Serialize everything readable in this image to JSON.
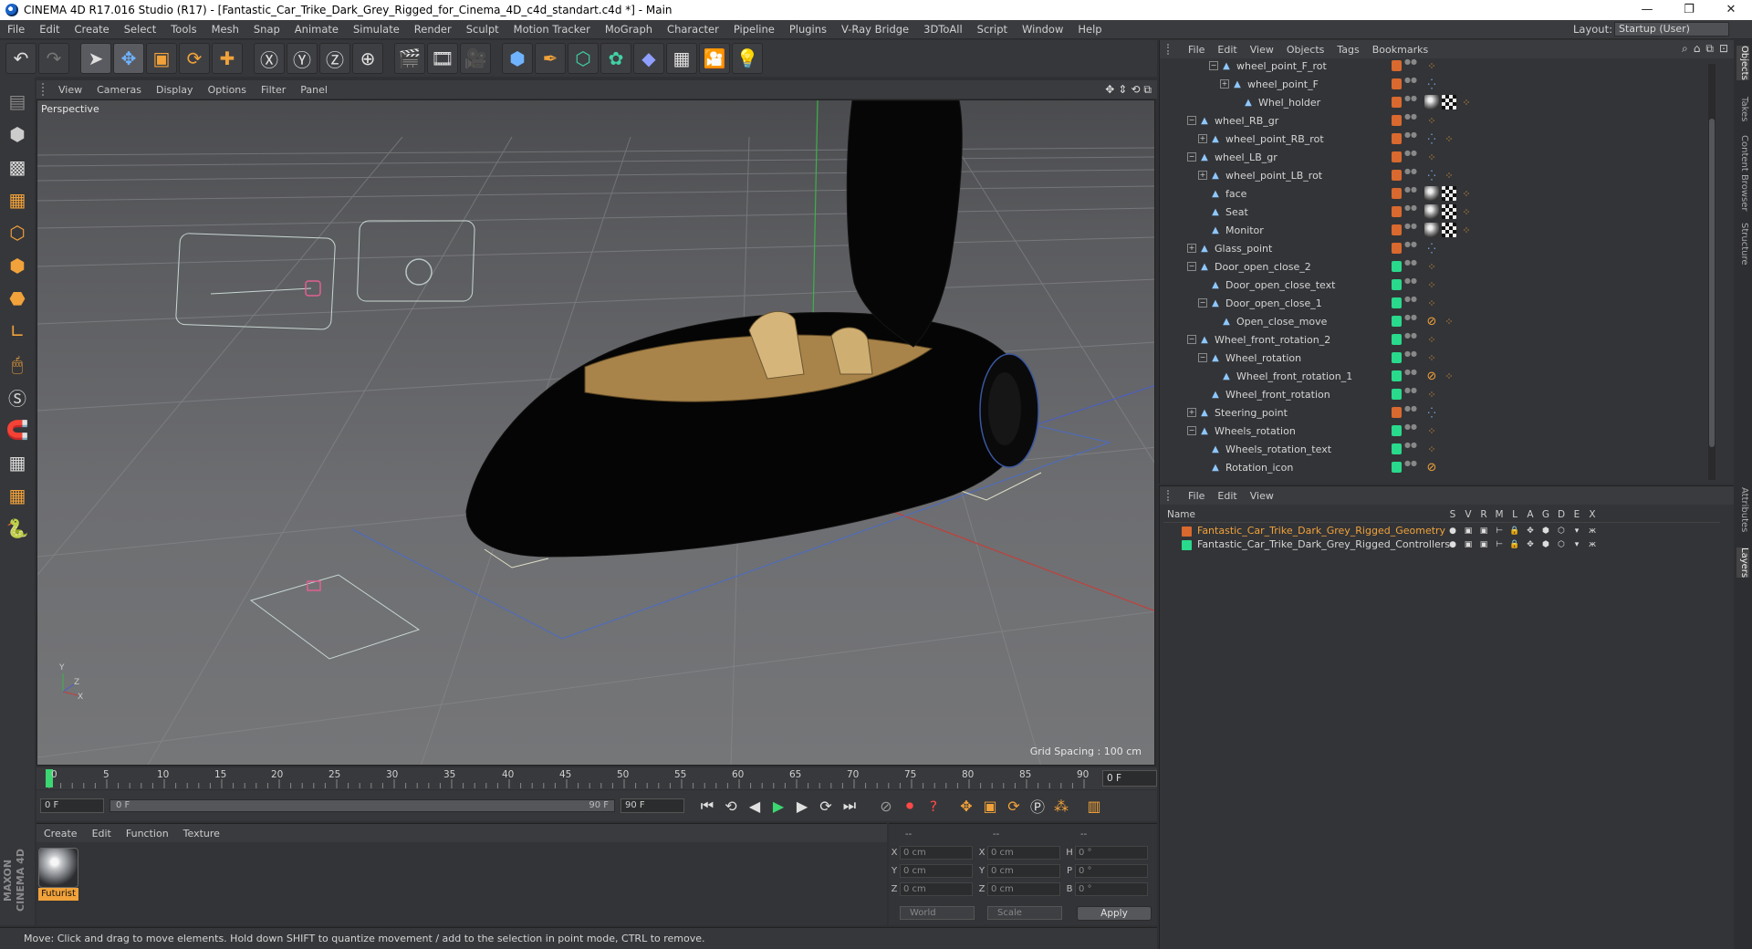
{
  "window": {
    "title": "CINEMA 4D R17.016 Studio (R17) - [Fantastic_Car_Trike_Dark_Grey_Rigged_for_Cinema_4D_c4d_standart.c4d *] - Main",
    "minimize": "—",
    "maximize": "❐",
    "close": "✕"
  },
  "menubar": {
    "items": [
      "File",
      "Edit",
      "Create",
      "Select",
      "Tools",
      "Mesh",
      "Snap",
      "Animate",
      "Simulate",
      "Render",
      "Sculpt",
      "Motion Tracker",
      "MoGraph",
      "Character",
      "Pipeline",
      "Plugins",
      "V-Ray Bridge",
      "3DToAll",
      "Script",
      "Window",
      "Help"
    ],
    "layout_label": "Layout:",
    "layout_value": "Startup (User)"
  },
  "viewport": {
    "menu": [
      "View",
      "Cameras",
      "Display",
      "Options",
      "Filter",
      "Panel"
    ],
    "camera_label": "Perspective",
    "grid_spacing": "Grid Spacing : 100 cm"
  },
  "timeline": {
    "ticks": [
      "0",
      "5",
      "10",
      "15",
      "20",
      "25",
      "30",
      "35",
      "40",
      "45",
      "50",
      "55",
      "60",
      "65",
      "70",
      "75",
      "80",
      "85",
      "90"
    ],
    "current_frame": "0 F"
  },
  "transport": {
    "start_field": "0 F",
    "range_start": "0 F",
    "range_end": "90 F",
    "end_field": "90 F"
  },
  "materials": {
    "menu": [
      "Create",
      "Edit",
      "Function",
      "Texture"
    ],
    "items": [
      {
        "label": "Futurist"
      }
    ]
  },
  "coords": {
    "headers": [
      "--",
      "--",
      "--"
    ],
    "rows": [
      {
        "l1": "X",
        "v1": "0 cm",
        "l2": "X",
        "v2": "0 cm",
        "l3": "H",
        "v3": "0 °"
      },
      {
        "l1": "Y",
        "v1": "0 cm",
        "l2": "Y",
        "v2": "0 cm",
        "l3": "P",
        "v3": "0 °"
      },
      {
        "l1": "Z",
        "v1": "0 cm",
        "l2": "Z",
        "v2": "0 cm",
        "l3": "B",
        "v3": "0 °"
      }
    ],
    "space": "World",
    "mode": "Scale",
    "apply": "Apply"
  },
  "status": "Move: Click and drag to move elements. Hold down SHIFT to quantize movement / add to the selection in point mode, CTRL to remove.",
  "objects": {
    "menu": [
      "File",
      "Edit",
      "View",
      "Objects",
      "Tags",
      "Bookmarks"
    ],
    "rows": [
      {
        "name": "wheel_point_F_rot",
        "indent": 4,
        "exp": "−",
        "layer": "#d9692e",
        "tags": [
          "constraint"
        ]
      },
      {
        "name": "wheel_point_F",
        "indent": 5,
        "exp": "+",
        "layer": "#d9692e",
        "tags": [
          "xpresso"
        ]
      },
      {
        "name": "Whel_holder",
        "indent": 6,
        "exp": "",
        "layer": "#d9692e",
        "tags": [
          "mat",
          "tex",
          "constraint"
        ]
      },
      {
        "name": "wheel_RB_gr",
        "indent": 2,
        "exp": "−",
        "layer": "#d9692e",
        "tags": [
          "constraint"
        ]
      },
      {
        "name": "wheel_point_RB_rot",
        "indent": 3,
        "exp": "+",
        "layer": "#d9692e",
        "tags": [
          "xpresso",
          "constraint"
        ]
      },
      {
        "name": "wheel_LB_gr",
        "indent": 2,
        "exp": "−",
        "layer": "#d9692e",
        "tags": [
          "constraint"
        ]
      },
      {
        "name": "wheel_point_LB_rot",
        "indent": 3,
        "exp": "+",
        "layer": "#d9692e",
        "tags": [
          "xpresso",
          "constraint"
        ]
      },
      {
        "name": "face",
        "indent": 3,
        "exp": "",
        "layer": "#d9692e",
        "tags": [
          "mat",
          "tex",
          "constraint"
        ]
      },
      {
        "name": "Seat",
        "indent": 3,
        "exp": "",
        "layer": "#d9692e",
        "tags": [
          "mat",
          "tex",
          "constraint"
        ]
      },
      {
        "name": "Monitor",
        "indent": 3,
        "exp": "",
        "layer": "#d9692e",
        "tags": [
          "mat",
          "tex",
          "constraint"
        ]
      },
      {
        "name": "Glass_point",
        "indent": 2,
        "exp": "+",
        "layer": "#d9692e",
        "tags": [
          "xpresso"
        ]
      },
      {
        "name": "Door_open_close_2",
        "indent": 2,
        "exp": "−",
        "layer": "#29d98c",
        "tags": [
          "constraint"
        ]
      },
      {
        "name": "Door_open_close_text",
        "indent": 3,
        "exp": "",
        "layer": "#29d98c",
        "tags": [
          "constraint"
        ]
      },
      {
        "name": "Door_open_close_1",
        "indent": 3,
        "exp": "−",
        "layer": "#29d98c",
        "tags": [
          "constraint"
        ]
      },
      {
        "name": "Open_close_move",
        "indent": 4,
        "exp": "",
        "layer": "#29d98c",
        "tags": [
          "forbid",
          "constraint"
        ]
      },
      {
        "name": "Wheel_front_rotation_2",
        "indent": 2,
        "exp": "−",
        "layer": "#29d98c",
        "tags": [
          "constraint"
        ]
      },
      {
        "name": "Wheel_rotation",
        "indent": 3,
        "exp": "−",
        "layer": "#29d98c",
        "tags": [
          "constraint"
        ]
      },
      {
        "name": "Wheel_front_rotation_1",
        "indent": 4,
        "exp": "",
        "layer": "#29d98c",
        "tags": [
          "forbid",
          "constraint"
        ]
      },
      {
        "name": "Wheel_front_rotation",
        "indent": 3,
        "exp": "",
        "layer": "#29d98c",
        "tags": [
          "constraint"
        ]
      },
      {
        "name": "Steering_point",
        "indent": 2,
        "exp": "+",
        "layer": "#d9692e",
        "tags": [
          "xpresso"
        ]
      },
      {
        "name": "Wheels_rotation",
        "indent": 2,
        "exp": "−",
        "layer": "#29d98c",
        "tags": [
          "constraint"
        ]
      },
      {
        "name": "Wheels_rotation_text",
        "indent": 3,
        "exp": "",
        "layer": "#29d98c",
        "tags": [
          "constraint"
        ]
      },
      {
        "name": "Rotation_icon",
        "indent": 3,
        "exp": "",
        "layer": "#29d98c",
        "tags": [
          "forbid"
        ]
      }
    ]
  },
  "layers": {
    "menu": [
      "File",
      "Edit",
      "View"
    ],
    "header": {
      "name": "Name",
      "cols": [
        "S",
        "V",
        "R",
        "M",
        "L",
        "A",
        "G",
        "D",
        "E",
        "X"
      ]
    },
    "rows": [
      {
        "name": "Fantastic_Car_Trike_Dark_Grey_Rigged_Geometry",
        "color": "#d9692e",
        "text_color": "#f1a23a"
      },
      {
        "name": "Fantastic_Car_Trike_Dark_Grey_Rigged_Controllers",
        "color": "#29d98c",
        "text_color": "#d4d4d4"
      }
    ]
  },
  "sidetabs": [
    "Objects",
    "Takes",
    "Content Browser",
    "Structure",
    "Attributes",
    "Layers"
  ],
  "colors": {
    "accent": "#f1a23a",
    "geometry_layer": "#d9692e",
    "controllers_layer": "#29d98c"
  }
}
